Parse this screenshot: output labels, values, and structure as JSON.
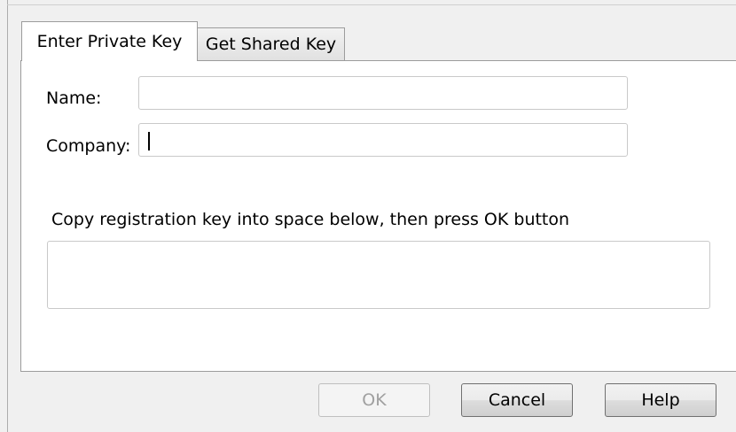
{
  "tabs": [
    {
      "label": "Enter Private Key",
      "active": true
    },
    {
      "label": "Get Shared Key",
      "active": false
    }
  ],
  "form": {
    "name_label": "Name:",
    "name_value": "",
    "company_label": "Company:",
    "company_value": "",
    "instruction": "Copy registration key into space below, then press OK button",
    "key_value": ""
  },
  "buttons": {
    "ok": "OK",
    "cancel": "Cancel",
    "help": "Help"
  }
}
